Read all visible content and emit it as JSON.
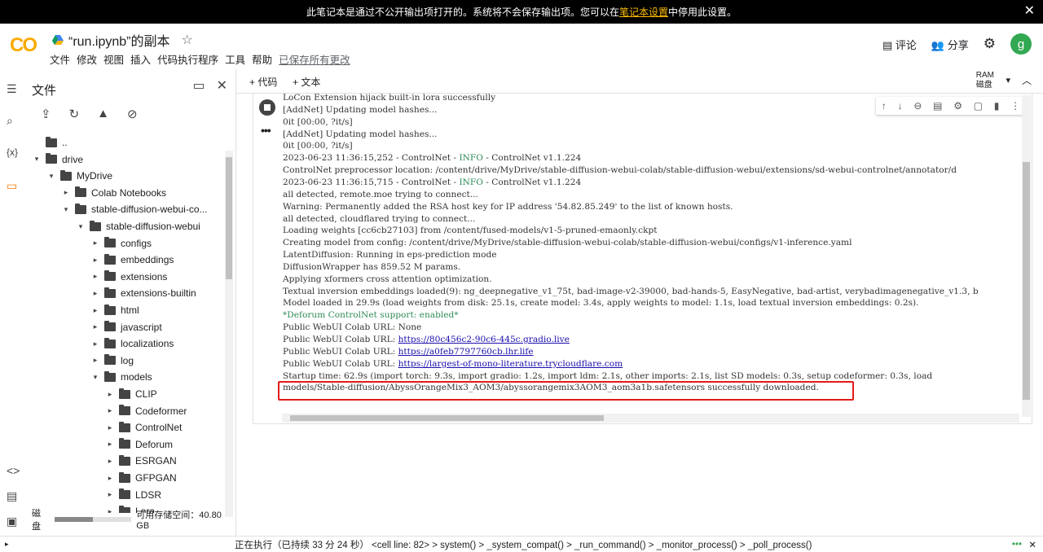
{
  "banner": {
    "text": "此笔记本是通过不公开输出项打开的。系统将不会保存输出项。您可以在",
    "link": "笔记本设置",
    "suffix": "中停用此设置。",
    "close": "✕"
  },
  "app": {
    "logo": "CO",
    "title": "“run.ipynb”的副本",
    "star": "☆"
  },
  "menu": [
    "文件",
    "修改",
    "视图",
    "插入",
    "代码执行程序",
    "工具",
    "帮助"
  ],
  "saved": "已保存所有更改",
  "header_right": {
    "comment": "评论",
    "share": "分享",
    "avatar": "g"
  },
  "files": {
    "title": "文件"
  },
  "tree": [
    {
      "label": "..",
      "depth": 0,
      "arrow": "",
      "parent": true
    },
    {
      "label": "drive",
      "depth": 0,
      "arrow": "▾"
    },
    {
      "label": "MyDrive",
      "depth": 1,
      "arrow": "▾"
    },
    {
      "label": "Colab Notebooks",
      "depth": 2,
      "arrow": "▸"
    },
    {
      "label": "stable-diffusion-webui-co...",
      "depth": 2,
      "arrow": "▾"
    },
    {
      "label": "stable-diffusion-webui",
      "depth": 3,
      "arrow": "▾"
    },
    {
      "label": "configs",
      "depth": 4,
      "arrow": "▸"
    },
    {
      "label": "embeddings",
      "depth": 4,
      "arrow": "▸"
    },
    {
      "label": "extensions",
      "depth": 4,
      "arrow": "▸"
    },
    {
      "label": "extensions-builtin",
      "depth": 4,
      "arrow": "▸"
    },
    {
      "label": "html",
      "depth": 4,
      "arrow": "▸"
    },
    {
      "label": "javascript",
      "depth": 4,
      "arrow": "▸"
    },
    {
      "label": "localizations",
      "depth": 4,
      "arrow": "▸"
    },
    {
      "label": "log",
      "depth": 4,
      "arrow": "▸"
    },
    {
      "label": "models",
      "depth": 4,
      "arrow": "▾"
    },
    {
      "label": "CLIP",
      "depth": 5,
      "arrow": "▸"
    },
    {
      "label": "Codeformer",
      "depth": 5,
      "arrow": "▸"
    },
    {
      "label": "ControlNet",
      "depth": 5,
      "arrow": "▸"
    },
    {
      "label": "Deforum",
      "depth": 5,
      "arrow": "▸"
    },
    {
      "label": "ESRGAN",
      "depth": 5,
      "arrow": "▸"
    },
    {
      "label": "GFPGAN",
      "depth": 5,
      "arrow": "▸"
    },
    {
      "label": "LDSR",
      "depth": 5,
      "arrow": "▸"
    },
    {
      "label": "Lora",
      "depth": 5,
      "arrow": "▸"
    }
  ],
  "disk": {
    "label": "磁盘",
    "available": "可用存储空间：40.80 GB",
    "used_fraction": 0.5
  },
  "toolbar": {
    "add_code": "+ 代码",
    "add_text": "+ 文本",
    "ram": "RAM",
    "disk": "磁盘"
  },
  "output": [
    {
      "t": "LoCon Extension hijack built-in lora successfully"
    },
    {
      "t": "[AddNet] Updating model hashes..."
    },
    {
      "t": "0it [00:00, ?it/s]"
    },
    {
      "t": "[AddNet] Updating model hashes..."
    },
    {
      "t": "0it [00:00, ?it/s]"
    },
    {
      "t": "2023-06-23 11:36:15,252 - ControlNet - ",
      "info": "INFO",
      "rest": " - ControlNet v1.1.224"
    },
    {
      "t": "ControlNet preprocessor location: /content/drive/MyDrive/stable-diffusion-webui-colab/stable-diffusion-webui/extensions/sd-webui-controlnet/annotator/d"
    },
    {
      "t": "2023-06-23 11:36:15,715 - ControlNet - ",
      "info": "INFO",
      "rest": " - ControlNet v1.1.224"
    },
    {
      "t": "all detected, remote.moe trying to connect..."
    },
    {
      "t": "Warning: Permanently added the RSA host key for IP address '54.82.85.249' to the list of known hosts."
    },
    {
      "t": "all detected, cloudflared trying to connect..."
    },
    {
      "t": "Loading weights [cc6cb27103] from /content/fused-models/v1-5-pruned-emaonly.ckpt"
    },
    {
      "t": "Creating model from config: /content/drive/MyDrive/stable-diffusion-webui-colab/stable-diffusion-webui/configs/v1-inference.yaml"
    },
    {
      "t": "LatentDiffusion: Running in eps-prediction mode"
    },
    {
      "t": "DiffusionWrapper has 859.52 M params."
    },
    {
      "t": "Applying xformers cross attention optimization."
    },
    {
      "t": "Textual inversion embeddings loaded(9): ng_deepnegative_v1_75t, bad-image-v2-39000, bad-hands-5, EasyNegative, bad-artist, verybadimagenegative_v1.3, b"
    },
    {
      "t": "Model loaded in 29.9s (load weights from disk: 25.1s, create model: 3.4s, apply weights to model: 1.1s, load textual inversion embeddings: 0.2s)."
    },
    {
      "t": "",
      "info": "*Deforum ControlNet support: enabled*"
    },
    {
      "t": "Public WebUI Colab URL: None"
    },
    {
      "t": "Public WebUI Colab URL: ",
      "link": "https://80c456c2-90c6-445c.gradio.live"
    },
    {
      "t": "Public WebUI Colab URL: ",
      "link": "https://a0feb7797760cb.lhr.life"
    },
    {
      "t": "Public WebUI Colab URL: ",
      "link": "https://largest-of-mono-literature.trycloudflare.com"
    },
    {
      "t": "Startup time: 62.9s (import torch: 9.3s, import gradio: 1.2s, import ldm: 2.1s, other imports: 2.1s, list SD models: 0.3s, setup codeformer: 0.3s, load"
    },
    {
      "t": "models/Stable-diffusion/AbyssOrangeMix3_AOM3/abyssorangemix3AOM3_aom3a1b.safetensors successfully downloaded."
    }
  ],
  "status": {
    "text": "正在执行（已持续 33 分 24 秒）   <cell line: 82> > system() > _system_compat() > _run_command() > _monitor_process() > _poll_process()",
    "dots": "•••"
  }
}
